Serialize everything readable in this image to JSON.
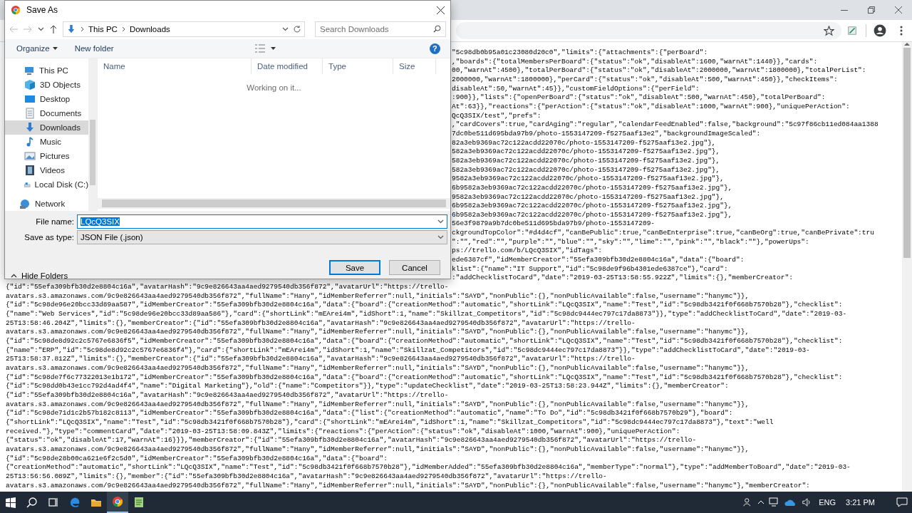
{
  "browser": {
    "upper_lines": [
      "\"5c98db0b95a01c23080d20c0\",\"limits\":{\"attachments\":{\"perBoard\":",
      ",\"boards\":{\"totalMembersPerBoard\":{\"status\":\"ok\",\"disableAt\":1600,\"warnAt\":1440}},\"cards\":",
      "00,\"warnAt\":4500},\"totalPerBoard\":{\"status\":\"ok\",\"disableAt\":2000000,\"warnAt\":1800000},\"totalPerList\":",
      "2000000,\"warnAt\":1800000},\"perCard\":{\"status\":\"ok\",\"disableAt\":500,\"warnAt\":450}},\"checkItems\":",
      "disableAt\":50,\"warnAt\":45}},\"customFieldOptions\":{\"perField\":",
      ":900}},\"lists\":{\"openPerBoard\":{\"status\":\"ok\",\"disableAt\":500,\"warnAt\":450},\"totalPerBoard\":",
      "At\":63}},\"reactions\":{\"perAction\":{\"status\":\"ok\",\"disableAt\":1000,\"warnAt\":900},\"uniquePerAction\":",
      "QcQ3SIX/test\",\"prefs\":",
      ",\"cardCovers\":true,\"cardAging\":\"regular\",\"calendarFeedEnabled\":false,\"background\":\"5c97f86cb11ed084aa1388",
      "7dc0be511d695bda97b9/photo-1553147209-f5275aaf13e2\",\"backgroundImageScaled\":",
      "82a3eb9369ac72c122acdd22070c/photo-1553147209-f5275aaf13e2.jpg\"},",
      "582a3eb9369ac72c122acdd22070c/photo-1553147209-f5275aaf13e2.jpg\"},",
      "582a3eb9369ac72c122acdd22070c/photo-1553147209-f5275aaf13e2.jpg\"},",
      "582a3eb9369ac72c122acdd22070c/photo-1553147209-f5275aaf13e2.jpg\"},",
      "9582a3eb9369ac72c122acdd22070c/photo-1553147209-f5275aaf13e2.jpg\"},",
      "6b9582a3eb9369ac72c122acdd22070c/photo-1553147209-f5275aaf13e2.jpg\"},",
      "9582a3eb9369ac72c122acdd22070c/photo-1553147209-f5275aaf13e2.jpg\"},",
      "6b9582a3eb9369ac72c122acdd22070c/photo-1553147209-f5275aaf13e2.jpg\"},",
      "6b9582a3eb9369ac72c122acdd22070c/photo-1553147209-f5275aaf13e2.jpg\"},",
      "56e3f9879a9b7dc0be511d695bda97b9/photo-1553147209-",
      "ckgroundTopColor\":\"#d4d4cf\",\"canBePublic\":true,\"canBeEnterprise\":true,\"canBeOrg\":true,\"canBePrivate\":tru",
      "\":\"\",\"red\":\"\",\"purple\":\"\",\"blue\":\"\",\"sky\":\"\",\"lime\":\"\",\"pink\":\"\",\"black\":\"\"},\"powerUps\":",
      "ps://trello.com/b/LQcQ3SIX\",\"idTags\":",
      "ede6387cf\",\"idMemberCreator\":\"55efa309bfb30d2e8804c16a\",\"data\":{\"board\":",
      "klist\":{\"name\":\"IT Support\",\"id\":\"5c98de9f96b4301ede6387ce\"},\"card\":",
      ":\"addChecklistToCard\",\"date\":\"2019-03-25T13:58:55.922Z\",\"limits\":{},\"memberCreator\":"
    ],
    "lower_lines": [
      "{\"id\":\"55efa309bfb30d2e8804c16a\",\"avatarHash\":\"9c9e826643aa4aed9279540db356f872\",\"avatarUrl\":\"https://trello-",
      "avatars.s3.amazonaws.com/9c9e826643aa4aed9279540db356f872\",\"fullName\":\"Hany\",\"idMemberReferrer\":null,\"initials\":\"SAYD\",\"nonPublic\":{},\"nonPublicAvailable\":false,\"username\":\"hanymc\"}},",
      "{\"id\":\"5c98de96e20bcc33d89aa587\",\"idMemberCreator\":\"55efa309bfb30d2e8804c16a\",\"data\":{\"board\":{\"creationMethod\":\"automatic\",\"shortLink\":\"LQcQ3SIX\",\"name\":\"Test\",\"id\":\"5c98db3421f0f668b7570b28\"},\"checklist\":",
      "{\"name\":\"Web Services\",\"id\":\"5c98de96e20bcc33d89aa586\"},\"card\":{\"shortLink\":\"mEArei4m\",\"idShort\":1,\"name\":\"Skillzat_Competitors\",\"id\":\"5c98dc9444ec797c17da8873\"}},\"type\":\"addChecklistToCard\",\"date\":\"2019-03-",
      "25T13:58:46.204Z\",\"limits\":{},\"memberCreator\":{\"id\":\"55efa309bfb30d2e8804c16a\",\"avatarHash\":\"9c9e826643aa4aed9279540db356f872\",\"avatarUrl\":\"https://trello-",
      "avatars.s3.amazonaws.com/9c9e826643aa4aed9279540db356f872\",\"fullName\":\"Hany\",\"idMemberReferrer\":null,\"initials\":\"SAYD\",\"nonPublic\":{},\"nonPublicAvailable\":false,\"username\":\"hanymc\"}},",
      "{\"id\":\"5c98de8d92c2c5767e6836f5\",\"idMemberCreator\":\"55efa309bfb30d2e8804c16a\",\"data\":{\"board\":{\"creationMethod\":\"automatic\",\"shortLink\":\"LQcQ3SIX\",\"name\":\"Test\",\"id\":\"5c98db3421f0f668b7570b28\"},\"checklist\":",
      "{\"name\":\"ERP\",\"id\":\"5c98de8d92c2c5767e6836f4\"},\"card\":{\"shortLink\":\"mEArei4m\",\"idShort\":1,\"name\":\"Skillzat_Competitors\",\"id\":\"5c98dc9444ec797c17da8873\"}},\"type\":\"addChecklistToCard\",\"date\":\"2019-03-",
      "25T13:58:37.812Z\",\"limits\":{},\"memberCreator\":{\"id\":\"55efa309bfb30d2e8804c16a\",\"avatarHash\":\"9c9e826643aa4aed9279540db356f872\",\"avatarUrl\":\"https://trello-",
      "avatars.s3.amazonaws.com/9c9e826643aa4aed9279540db356f872\",\"fullName\":\"Hany\",\"idMemberReferrer\":null,\"initials\":\"SAYD\",\"nonPublic\":{},\"nonPublicAvailable\":false,\"username\":\"hanymc\"}},",
      "{\"id\":\"5c98de7f6c77322013e1b172\",\"idMemberCreator\":\"55efa309bfb30d2e8804c16a\",\"data\":{\"board\":{\"creationMethod\":\"automatic\",\"shortLink\":\"LQcQ3SIX\",\"name\":\"Test\",\"id\":\"5c98db3421f0f668b7570b28\"},\"checklist\":",
      "{\"id\":\"5c98dd0b43e1cc792d4ad4f4\",\"name\":\"Digital Marketing\"},\"old\":{\"name\":\"Competitors\"}},\"type\":\"updateChecklist\",\"date\":\"2019-03-25T13:58:23.944Z\",\"limits\":{},\"memberCreator\":",
      "{\"id\":\"55efa309bfb30d2e8804c16a\",\"avatarHash\":\"9c9e826643aa4aed9279540db356f872\",\"avatarUrl\":\"https://trello-",
      "avatars.s3.amazonaws.com/9c9e826643aa4aed9279540db356f872\",\"fullName\":\"Hany\",\"idMemberReferrer\":null,\"initials\":\"SAYD\",\"nonPublic\":{},\"nonPublicAvailable\":false,\"username\":\"hanymc\"}},",
      "{\"id\":\"5c98de71d1c2b57b182c8113\",\"idMemberCreator\":\"55efa309bfb30d2e8804c16a\",\"data\":{\"list\":{\"creationMethod\":\"automatic\",\"name\":\"To Do\",\"id\":\"5c98db3421f0f668b7570b29\"},\"board\":",
      "{\"shortLink\":\"LQcQ3SIX\",\"name\":\"Test\",\"id\":\"5c98db3421f0f668b7570b28\"},\"card\":{\"shortLink\":\"mEArei4m\",\"idShort\":1,\"name\":\"Skillzat_Competitors\",\"id\":\"5c98dc9444ec797c17da8873\"},\"text\":\"well",
      "received.\"},\"type\":\"commentCard\",\"date\":\"2019-03-25T13:58:09.843Z\",\"limits\":{\"reactions\":{\"perAction\":{\"status\":\"ok\",\"disableAt\":1000,\"warnAt\":900},\"uniquePerAction\":",
      "{\"status\":\"ok\",\"disableAt\":17,\"warnAt\":16}}},\"memberCreator\":{\"id\":\"55efa309bfb30d2e8804c16a\",\"avatarHash\":\"9c9e826643aa4aed9279540db356f872\",\"avatarUrl\":\"https://trello-",
      "avatars.s3.amazonaws.com/9c9e826643aa4aed9279540db356f872\",\"fullName\":\"Hany\",\"idMemberReferrer\":null,\"initials\":\"SAYD\",\"nonPublic\":{},\"nonPublicAvailable\":false,\"username\":\"hanymc\"}},",
      "{\"id\":\"5c98de28b00ca621e6f2c5d0\",\"idMemberCreator\":\"55efa309bfb30d2e8804c16a\",\"data\":{\"board\":",
      "{\"creationMethod\":\"automatic\",\"shortLink\":\"LQcQ3SIX\",\"name\":\"Test\",\"id\":\"5c98db3421f0f668b7570b28\"},\"idMemberAdded\":\"55efa309bfb30d2e8804c16a\",\"memberType\":\"normal\"},\"type\":\"addMemberToBoard\",\"date\":\"2019-03-",
      "25T13:56:56.089Z\",\"limits\":{},\"member\":{\"id\":\"55efa309bfb30d2e8804c16a\",\"avatarHash\":\"9c9e826643aa4aed9279540db356f872\",\"avatarUrl\":\"https://trello-",
      "avatars.s3.amazonaws.com/9c9e826643aa4aed9279540db356f872\",\"fullName\":\"Hany\",\"idMemberReferrer\":null,\"initials\":\"SAYD\",\"nonPublic\":{},\"nonPublicAvailable\":false,\"username\":\"hanymc\"},\"memberCreator\":"
    ]
  },
  "dialog": {
    "title": "Save As",
    "path": [
      "This PC",
      "Downloads"
    ],
    "search": {
      "placeholder": "Search Downloads"
    },
    "toolbar": {
      "organize": "Organize",
      "new_folder": "New folder",
      "help": "?"
    },
    "tree": [
      {
        "label": "This PC",
        "kind": "pc",
        "selected": false,
        "children": [
          {
            "label": "3D Objects",
            "kind": "objects",
            "selected": false
          },
          {
            "label": "Desktop",
            "kind": "desktop",
            "selected": false
          },
          {
            "label": "Documents",
            "kind": "documents",
            "selected": false
          },
          {
            "label": "Downloads",
            "kind": "downloads",
            "selected": true
          },
          {
            "label": "Music",
            "kind": "music",
            "selected": false
          },
          {
            "label": "Pictures",
            "kind": "pictures",
            "selected": false
          },
          {
            "label": "Videos",
            "kind": "videos",
            "selected": false
          },
          {
            "label": "Local Disk (C:)",
            "kind": "disk",
            "selected": false
          }
        ]
      },
      {
        "label": "Network",
        "kind": "network",
        "selected": false
      }
    ],
    "columns": [
      "Name",
      "Date modified",
      "Type",
      "Size"
    ],
    "status": "Working on it...",
    "file_name": {
      "label": "File name:",
      "value": "LQcQ3SIX",
      "value_selected": true
    },
    "save_as_type": {
      "label": "Save as type:",
      "value": "JSON File (.json)"
    },
    "hide_folders": "Hide Folders",
    "buttons": [
      {
        "label": "Save",
        "default": true
      },
      {
        "label": "Cancel",
        "default": false
      }
    ]
  },
  "taskbar": {
    "apps": [
      {
        "kind": "start",
        "active": false
      },
      {
        "kind": "search",
        "active": false
      },
      {
        "kind": "taskview",
        "active": false
      },
      {
        "kind": "edge",
        "active": false
      },
      {
        "kind": "explorer",
        "active": false
      },
      {
        "kind": "chrome",
        "active": true
      },
      {
        "kind": "notepad",
        "active": false
      }
    ],
    "language": "ENG",
    "clock": "3:21 PM"
  }
}
